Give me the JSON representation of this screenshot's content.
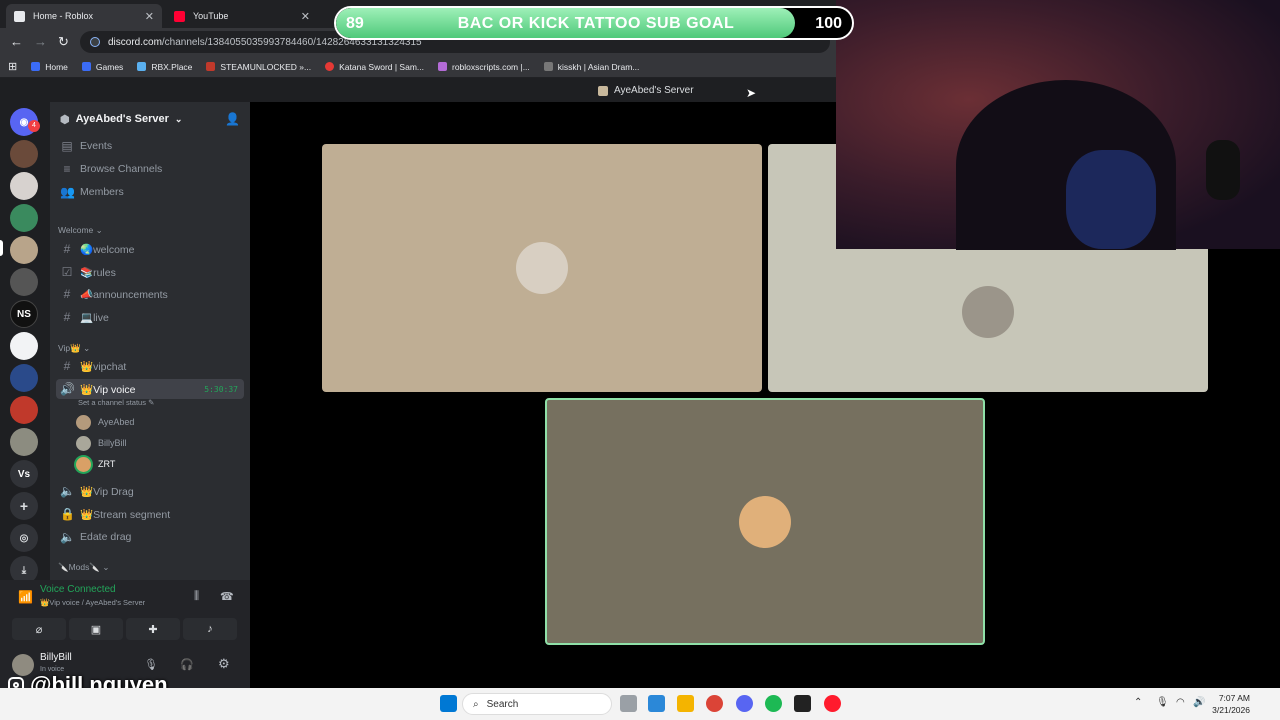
{
  "browser": {
    "tabs": [
      {
        "label": "Home - Roblox",
        "active": true
      },
      {
        "label": "YouTube",
        "active": false
      }
    ],
    "url_prefix": "discord.com",
    "url_rest": "/channels/1384055035993784460/1428264633131324315",
    "bookmarks": [
      "Home",
      "Games",
      "RBX.Place",
      "STEAMUNLOCKED »...",
      "Katana Sword | Sam...",
      "robloxscripts.com |...",
      "kisskh | Asian Dram..."
    ]
  },
  "goal": {
    "current": "89",
    "title": "BAC OR KICK TATTOO SUB GOAL",
    "target": "100",
    "progress_fraction": 0.89
  },
  "discord": {
    "top_server_name": "AyeAbed's Server",
    "guild_badge": "4",
    "guild_labels": {
      "ns": "NS",
      "vs": "Vs"
    },
    "server_name": "AyeAbed's Server",
    "nav": {
      "events": "Events",
      "browse": "Browse Channels",
      "members": "Members"
    },
    "categories": {
      "welcome": "Welcome",
      "vip": "Vip👑",
      "mods": "🔪Mods🔪"
    },
    "channels": {
      "welcome": "🌏welcome",
      "rules": "📚rules",
      "announcements": "📣announcements",
      "live": "💻live",
      "vipchat": "👑vipchat",
      "vip_voice": "👑Vip voice",
      "vip_drag": "👑Vip Drag",
      "stream_segment": "👑Stream segment",
      "edate_drag": "Edate drag"
    },
    "voice_timer": "5:30:37",
    "channel_status": "Set a channel status",
    "voice_members": [
      "AyeAbed",
      "BillyBill",
      "ZRT"
    ],
    "voice_panel": {
      "status": "Voice Connected",
      "sub": "👑Vip voice / AyeAbed's Server"
    },
    "user": {
      "name": "BillyBill",
      "sub": "In voice"
    }
  },
  "social": {
    "handle": "@bill.nguyen"
  },
  "taskbar": {
    "search_label": "Search",
    "time": "7:07 AM",
    "date": "3/21/2026"
  },
  "colors": {
    "accent_green": "#23a55a",
    "goal_green": "#4fc97a",
    "tile_a": "#bfae94",
    "tile_b": "#c7c6b8",
    "tile_c": "#76705f"
  }
}
